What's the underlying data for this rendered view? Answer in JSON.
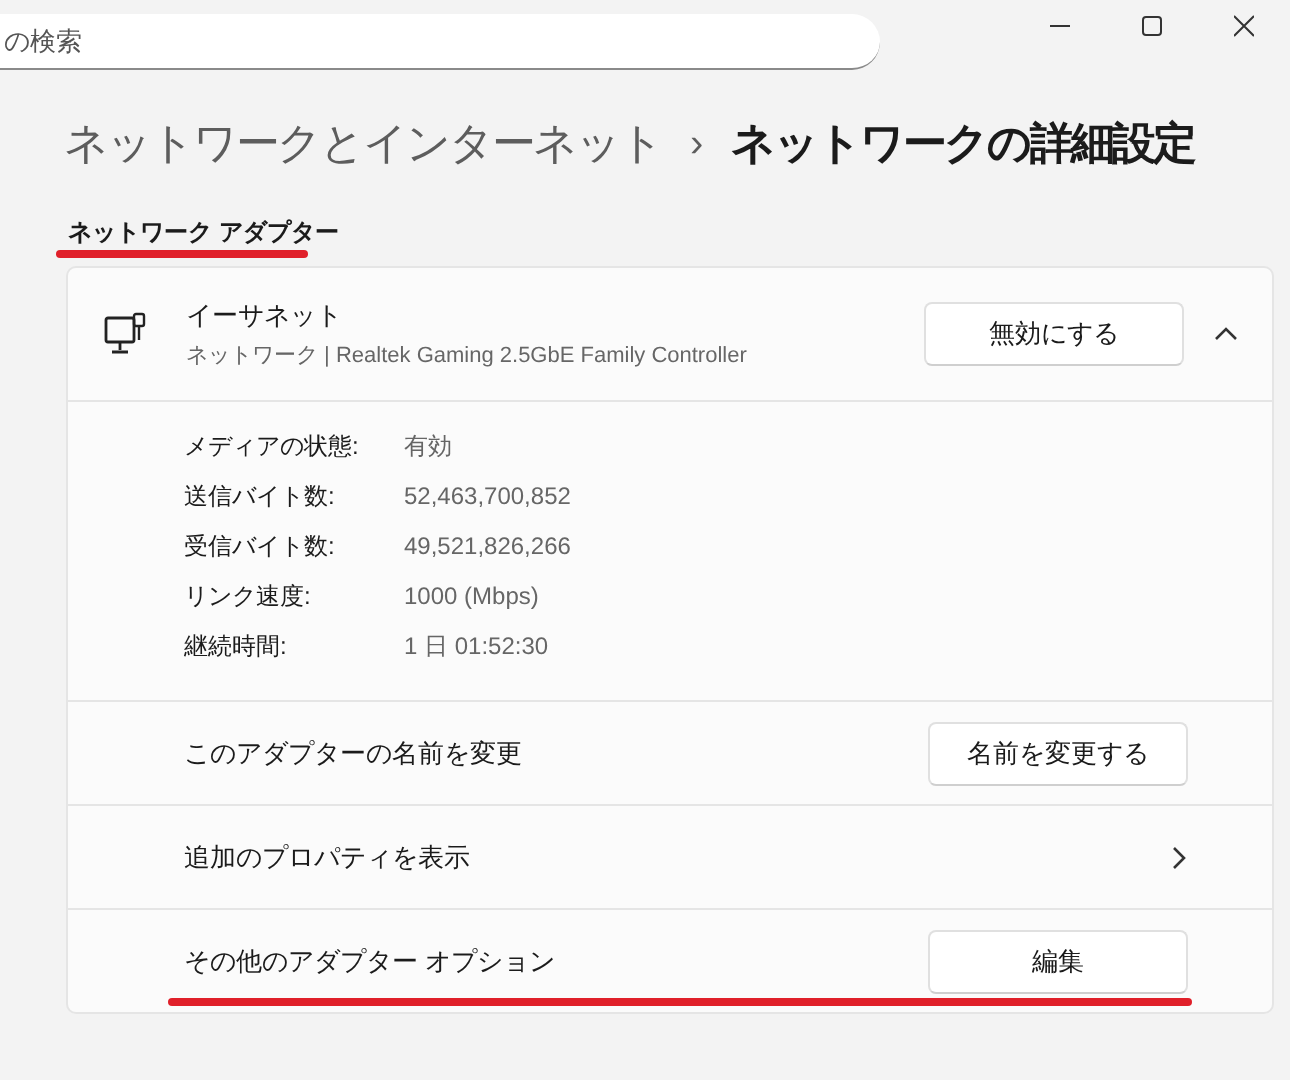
{
  "search": {
    "placeholder": "の検索"
  },
  "breadcrumb": {
    "parent": "ネットワークとインターネット",
    "separator": "›",
    "current": "ネットワークの詳細設定"
  },
  "section": {
    "title": "ネットワーク アダプター",
    "highlighted": true
  },
  "adapter": {
    "name": "イーサネット",
    "description": "ネットワーク | Realtek Gaming 2.5GbE Family Controller",
    "button": "無効にする",
    "expanded": true,
    "details": [
      {
        "label": "メディアの状態:",
        "value": "有効"
      },
      {
        "label": "送信バイト数:",
        "value": "52,463,700,852"
      },
      {
        "label": "受信バイト数:",
        "value": "49,521,826,266"
      },
      {
        "label": "リンク速度:",
        "value": "1000 (Mbps)"
      },
      {
        "label": "継続時間:",
        "value": "1 日 01:52:30"
      }
    ]
  },
  "rows": [
    {
      "kind": "button",
      "label": "このアダプターの名前を変更",
      "button": "名前を変更する",
      "highlighted": false
    },
    {
      "kind": "link",
      "label": "追加のプロパティを表示",
      "highlighted": false
    },
    {
      "kind": "button",
      "label": "その他のアダプター オプション",
      "button": "編集",
      "highlighted": true
    }
  ]
}
